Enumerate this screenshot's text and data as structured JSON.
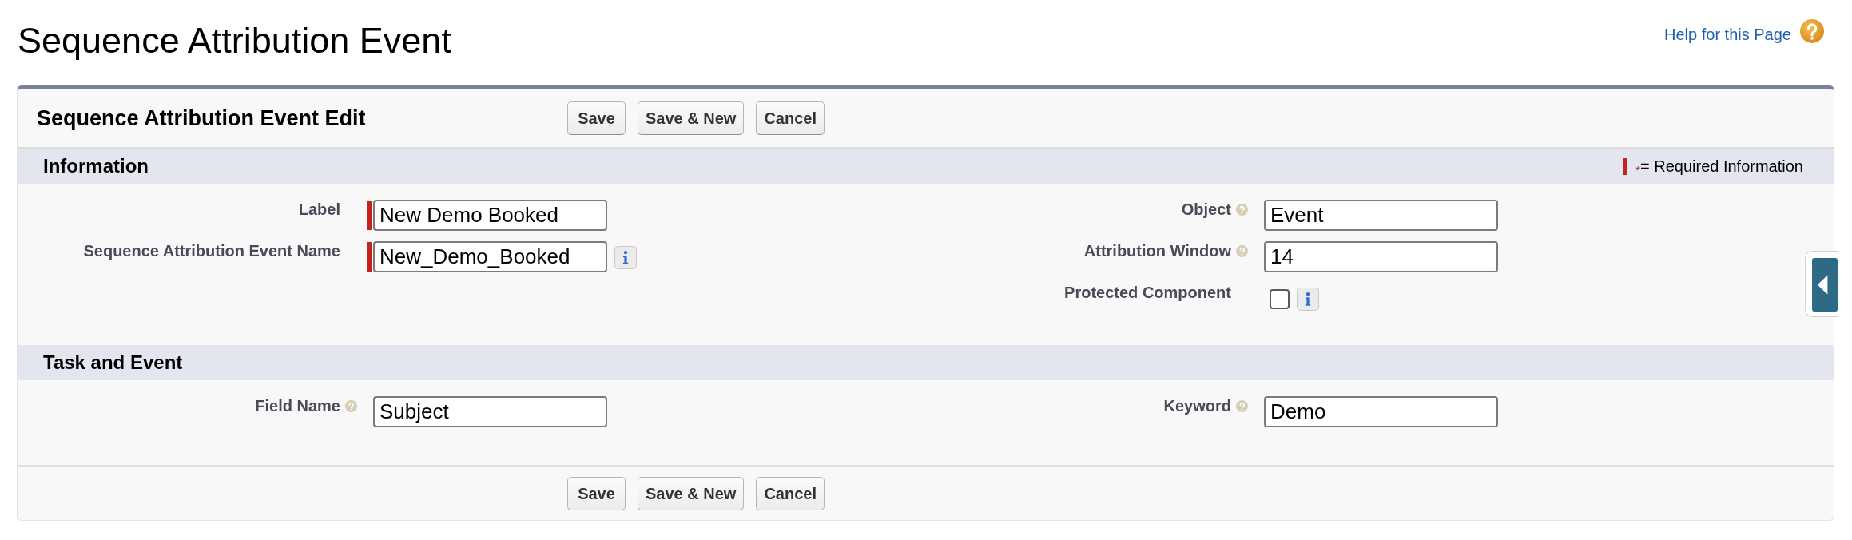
{
  "page": {
    "title": "Sequence Attribution Event",
    "help_link": "Help for this Page"
  },
  "edit_panel": {
    "title": "Sequence Attribution Event Edit",
    "top_buttons": [
      "Save",
      "Save & New",
      "Cancel"
    ],
    "bottom_buttons": [
      "Save",
      "Save & New",
      "Cancel"
    ]
  },
  "sections": [
    {
      "title": "Information",
      "legend": {
        "mark": "*",
        "text": "= Required Information"
      },
      "left_fields": [
        {
          "label": "Label",
          "kind": "text",
          "value": "New Demo Booked",
          "required": true,
          "help": false,
          "info": false
        },
        {
          "label": "Sequence Attribution Event Name",
          "kind": "text",
          "value": "New_Demo_Booked",
          "required": true,
          "help": false,
          "info": true
        }
      ],
      "right_fields": [
        {
          "label": "Object",
          "kind": "text",
          "value": "Event",
          "required": false,
          "help": true,
          "info": false
        },
        {
          "label": "Attribution Window",
          "kind": "text",
          "value": "14",
          "required": false,
          "help": true,
          "info": false
        },
        {
          "label": "Protected Component",
          "kind": "checkbox",
          "checked": false,
          "required": false,
          "help": false,
          "info": true
        }
      ]
    },
    {
      "title": "Task and Event",
      "left_fields": [
        {
          "label": "Field Name",
          "kind": "text",
          "value": "Subject",
          "required": false,
          "help": true,
          "info": false
        }
      ],
      "right_fields": [
        {
          "label": "Keyword",
          "kind": "text",
          "value": "Demo",
          "required": false,
          "help": true,
          "info": false
        }
      ]
    }
  ]
}
